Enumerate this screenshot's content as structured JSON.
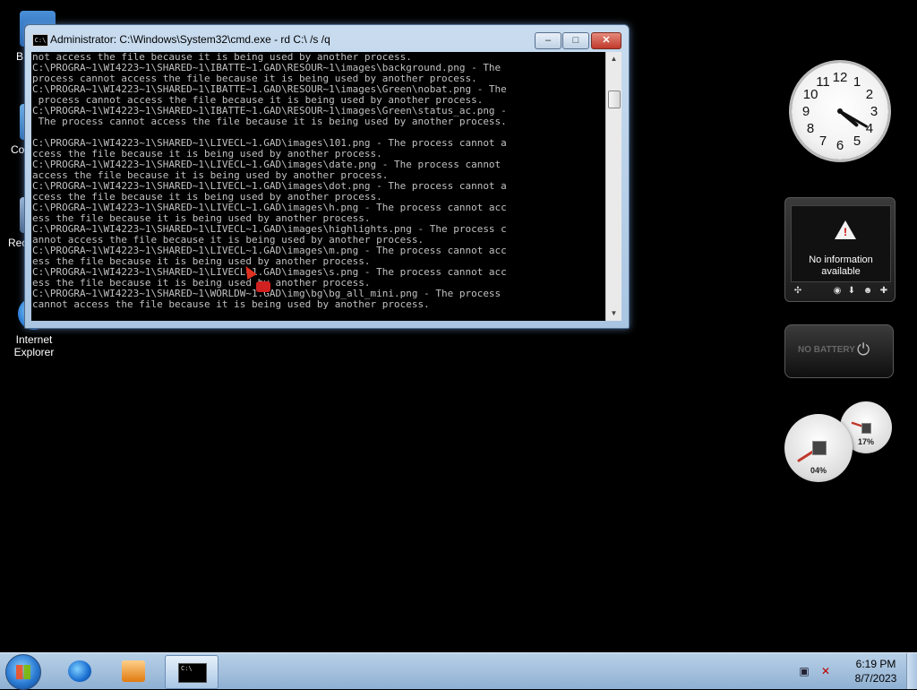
{
  "desktop": {
    "icons": [
      {
        "label": "B",
        "type": "folder"
      },
      {
        "label": "Co",
        "type": "computer"
      },
      {
        "label": "Rec",
        "type": "recycle-bin"
      },
      {
        "label": "Internet Explorer",
        "type": "ie"
      }
    ]
  },
  "cmd_window": {
    "title": "Administrator: C:\\Windows\\System32\\cmd.exe - rd  C:\\ /s /q",
    "icon_text": "C:\\",
    "buttons": {
      "minimize": "‒",
      "maximize": "□",
      "close": "✕"
    },
    "lines": [
      "not access the file because it is being used by another process.",
      "C:\\PROGRA~1\\WI4223~1\\SHARED~1\\IBATTE~1.GAD\\RESOUR~1\\images\\background.png - The",
      "process cannot access the file because it is being used by another process.",
      "C:\\PROGRA~1\\WI4223~1\\SHARED~1\\IBATTE~1.GAD\\RESOUR~1\\images\\Green\\nobat.png - The",
      " process cannot access the file because it is being used by another process.",
      "C:\\PROGRA~1\\WI4223~1\\SHARED~1\\IBATTE~1.GAD\\RESOUR~1\\images\\Green\\status_ac.png -",
      " The process cannot access the file because it is being used by another process.",
      "",
      "C:\\PROGRA~1\\WI4223~1\\SHARED~1\\LIVECL~1.GAD\\images\\101.png - The process cannot a",
      "ccess the file because it is being used by another process.",
      "C:\\PROGRA~1\\WI4223~1\\SHARED~1\\LIVECL~1.GAD\\images\\date.png - The process cannot",
      "access the file because it is being used by another process.",
      "C:\\PROGRA~1\\WI4223~1\\SHARED~1\\LIVECL~1.GAD\\images\\dot.png - The process cannot a",
      "ccess the file because it is being used by another process.",
      "C:\\PROGRA~1\\WI4223~1\\SHARED~1\\LIVECL~1.GAD\\images\\h.png - The process cannot acc",
      "ess the file because it is being used by another process.",
      "C:\\PROGRA~1\\WI4223~1\\SHARED~1\\LIVECL~1.GAD\\images\\highlights.png - The process c",
      "annot access the file because it is being used by another process.",
      "C:\\PROGRA~1\\WI4223~1\\SHARED~1\\LIVECL~1.GAD\\images\\m.png - The process cannot acc",
      "ess the file because it is being used by another process.",
      "C:\\PROGRA~1\\WI4223~1\\SHARED~1\\LIVECL~1.GAD\\images\\s.png - The process cannot acc",
      "ess the file because it is being used by another process.",
      "C:\\PROGRA~1\\WI4223~1\\SHARED~1\\WORLDW~1.GAD\\img\\bg\\bg_all_mini.png - The process",
      "cannot access the file because it is being used by another process."
    ]
  },
  "gadgets": {
    "clock": {
      "numerals": [
        "12",
        "1",
        "2",
        "3",
        "4",
        "5",
        "6",
        "7",
        "8",
        "9",
        "10",
        "11"
      ],
      "hour": 4,
      "minute": 20
    },
    "weather": {
      "message": "No information available",
      "line1": "No information",
      "line2": "available"
    },
    "battery": {
      "label": "NO BATTERY"
    },
    "meters": {
      "cpu_percent": "04%",
      "memory_percent": "17%"
    }
  },
  "taskbar": {
    "pinned": [
      "Internet Explorer",
      "Windows Media Player",
      "Command Prompt"
    ],
    "clock": {
      "time": "6:19 PM",
      "date": "8/7/2023"
    }
  },
  "colors": {
    "console_text": "#c0c0c0",
    "console_bg": "#000000",
    "taskbar": "#a9c6e4",
    "close_button": "#c0392b"
  }
}
